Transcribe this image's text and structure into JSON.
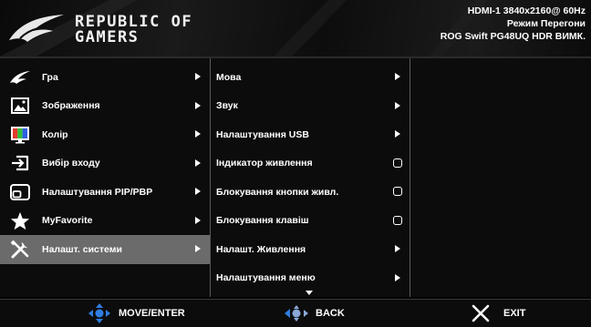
{
  "header": {
    "brand_line1": "REPUBLIC OF",
    "brand_line2": "GAMERS",
    "input_info": "HDMI-1  3840x2160@  60Hz",
    "mode": "Режим Перегони",
    "model": "ROG Swift  PG48UQ  HDR ВИМК."
  },
  "main_menu": [
    {
      "label": "Гра",
      "icon": "rog-eye-icon"
    },
    {
      "label": "Зображення",
      "icon": "image-icon"
    },
    {
      "label": "Колір",
      "icon": "color-icon"
    },
    {
      "label": "Вибір входу",
      "icon": "input-icon"
    },
    {
      "label": "Налаштування PIP/PBP",
      "icon": "pip-icon"
    },
    {
      "label": "MyFavorite",
      "icon": "star-icon"
    },
    {
      "label": "Налашт. системи",
      "icon": "wrench-screwdriver-icon",
      "active": true
    }
  ],
  "submenu": [
    {
      "label": "Мова",
      "control": "arrow"
    },
    {
      "label": "Звук",
      "control": "arrow"
    },
    {
      "label": "Налаштування USB",
      "control": "arrow"
    },
    {
      "label": "Індикатор живлення",
      "control": "checkbox"
    },
    {
      "label": "Блокування кнопки живл.",
      "control": "checkbox"
    },
    {
      "label": "Блокування клавіш",
      "control": "checkbox"
    },
    {
      "label": "Налашт. Живлення",
      "control": "arrow"
    },
    {
      "label": "Налаштування меню",
      "control": "arrow"
    }
  ],
  "footer": {
    "move_enter": "MOVE/ENTER",
    "back": "BACK",
    "exit": "EXIT"
  },
  "colors": {
    "background": "#000000",
    "active_item": "#6b6b6b",
    "joystick_blue": "#2f7de1",
    "text": "#ffffff"
  }
}
